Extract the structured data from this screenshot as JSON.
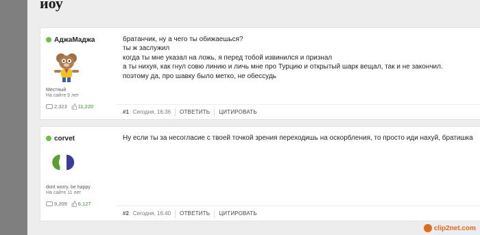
{
  "page": {
    "title": "иоу"
  },
  "posts": [
    {
      "author": "АджаМаджа",
      "rank": "Местный",
      "since": "На сайте 9 лет",
      "posts_count": "2,323",
      "reputation": "11,220",
      "lines": [
        "братанчик, ну а чего ты обижаешься?",
        "ты ж заслужил",
        "когда ты мне указал на ложь, я перед тобой извинился и признал",
        "а ты нихуя, как гнул совю линию и личь мне про Турцию и открытый шарк вещал, так и не закончил.",
        "поэтому да, про шавку было метко, не обессудь"
      ],
      "number": "#1",
      "date": "Сегодня, 16:36",
      "reply": "ОТВЕТИТЬ",
      "quote": "ЦИТИРОВАТЬ"
    },
    {
      "author": "corvet",
      "rank": "dont worry, be happy",
      "since": "На сайте 11 лет",
      "posts_count": "9,209",
      "reputation": "6,127",
      "lines": [
        "Ну если ты за несогласие с твоей точкой зрения переходишь на оскорбления, то просто иди нахуй, братишка"
      ],
      "number": "#2",
      "date": "Сегодня, 16:40",
      "reply": "ОТВЕТИТЬ",
      "quote": "ЦИТИРОВАТЬ"
    }
  ],
  "watermark": "clip2net.com"
}
